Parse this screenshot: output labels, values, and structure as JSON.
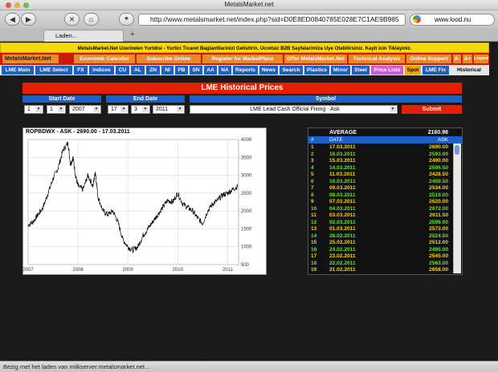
{
  "window": {
    "title": "MetalsMarket.net"
  },
  "toolbar": {
    "back_label": "◀",
    "forward_label": "▶",
    "stop_label": "✕",
    "home_label": "⌂",
    "url": "http://www.metalsmarket.net/index.php?sid=D0E8ED0840785E028E7C1AE9B985",
    "search_value": "www.lood.nu"
  },
  "tabs": [
    {
      "label": "Laden..."
    }
  ],
  "newtab_label": "+",
  "banner": "MetalsMarket.Net Uzerinden Yurtdisi - Yurtici Ticaret Baglantilarinizi Gelistirin. Ucretsiz B2B Sayfalarimiza Uye Olabilirsiniz. Kayit icin Tiklayiniz.",
  "menu1": {
    "brand": "MetalsMarket.Net",
    "items": [
      "Economic Calendar",
      "Subscribe Online",
      "Register for MarketPlace",
      "Offer MetalsMarket.Net",
      "Technical Analysis",
      "Online Support",
      "A-",
      "A+",
      "Logout"
    ]
  },
  "menu2": {
    "items": [
      "LME Main",
      "LME Select",
      "FX",
      "Indices",
      "CU",
      "AL",
      "ZN",
      "NI",
      "PB",
      "SN",
      "AA",
      "NA",
      "Reports",
      "News",
      "Search",
      "Plastics",
      "Minor",
      "Steel",
      "Price Lists",
      "Spot",
      "LME Fix",
      "Historical"
    ]
  },
  "heading": "LME Historical Prices",
  "form": {
    "start_label": "Start Date",
    "end_label": "End Date",
    "symbol_label": "Symbol",
    "start_day": "1",
    "start_month": "1",
    "start_year": "2007",
    "end_day": "17",
    "end_month": "3",
    "end_year": "2011",
    "symbol": "LME Lead Cash Official Fixing - Ask",
    "submit": "Submit"
  },
  "chart_title": "ROPBDWX - ASK - 2690.00 - 17.03.2011",
  "chart_data": {
    "type": "line",
    "title": "ROPBDWX - ASK - 2690.00 - 17.03.2011",
    "x": [
      2007.0,
      2007.1,
      2007.2,
      2007.3,
      2007.4,
      2007.5,
      2007.6,
      2007.7,
      2007.8,
      2007.85,
      2007.9,
      2007.95,
      2008.0,
      2008.1,
      2008.2,
      2008.3,
      2008.35,
      2008.4,
      2008.5,
      2008.6,
      2008.7,
      2008.8,
      2008.9,
      2009.0,
      2009.1,
      2009.2,
      2009.3,
      2009.4,
      2009.5,
      2009.6,
      2009.7,
      2009.8,
      2009.9,
      2010.0,
      2010.1,
      2010.2,
      2010.3,
      2010.4,
      2010.5,
      2010.6,
      2010.7,
      2010.8,
      2010.9,
      2011.0,
      2011.1,
      2011.2
    ],
    "values": [
      1600,
      1700,
      1900,
      2100,
      2500,
      2900,
      3200,
      3700,
      3900,
      3300,
      3500,
      3000,
      2700,
      2600,
      3000,
      2700,
      3100,
      2400,
      2000,
      1900,
      2000,
      1700,
      1200,
      1000,
      900,
      1000,
      1300,
      1500,
      1700,
      1900,
      2100,
      2300,
      2250,
      2500,
      2200,
      2100,
      2000,
      1800,
      1650,
      2000,
      2200,
      2300,
      2450,
      2500,
      2600,
      2690
    ],
    "xticks": [
      "2007",
      "2008",
      "2009",
      "2010",
      "2011"
    ],
    "yticks": [
      "4000",
      "3500",
      "3000",
      "2500",
      "2000",
      "1500",
      "1000",
      "500"
    ],
    "xlim": [
      2007.0,
      2011.22
    ],
    "ylim": [
      500,
      4000
    ],
    "grid": true,
    "color": "#000000"
  },
  "table": {
    "average_label": "AVERAGE",
    "average_value": "2160.96",
    "col_num": "#",
    "col_date": "DATE",
    "col_ask": "ASK",
    "rows": [
      {
        "n": "1",
        "date": "17.03.2011",
        "ask": "2690.00"
      },
      {
        "n": "2",
        "date": "16.03.2011",
        "ask": "2593.00"
      },
      {
        "n": "3",
        "date": "15.03.2011",
        "ask": "2490.00"
      },
      {
        "n": "4",
        "date": "14.03.2011",
        "ask": "2506.50"
      },
      {
        "n": "5",
        "date": "11.03.2011",
        "ask": "2428.50"
      },
      {
        "n": "6",
        "date": "10.03.2011",
        "ask": "2459.50"
      },
      {
        "n": "7",
        "date": "09.03.2011",
        "ask": "2534.00"
      },
      {
        "n": "8",
        "date": "08.03.2011",
        "ask": "2519.00"
      },
      {
        "n": "9",
        "date": "07.03.2011",
        "ask": "2620.00"
      },
      {
        "n": "10",
        "date": "04.03.2011",
        "ask": "2672.00"
      },
      {
        "n": "11",
        "date": "03.03.2011",
        "ask": "2611.50"
      },
      {
        "n": "12",
        "date": "02.03.2011",
        "ask": "2599.00"
      },
      {
        "n": "13",
        "date": "01.03.2011",
        "ask": "2573.00"
      },
      {
        "n": "14",
        "date": "28.02.2011",
        "ask": "2524.50"
      },
      {
        "n": "15",
        "date": "25.02.2011",
        "ask": "2512.00"
      },
      {
        "n": "16",
        "date": "24.02.2011",
        "ask": "2485.00"
      },
      {
        "n": "17",
        "date": "23.02.2011",
        "ask": "2545.00"
      },
      {
        "n": "18",
        "date": "22.02.2011",
        "ask": "2563.00"
      },
      {
        "n": "19",
        "date": "21.02.2011",
        "ask": "2658.00"
      }
    ]
  },
  "status": "Bezig met het laden van milkserver.metalsmarket.net...",
  "colors": {
    "accent_red": "#e42000",
    "nav_blue": "#1b61c9",
    "banner_yellow": "#f7d80c",
    "row_even": "#ffd400",
    "row_odd": "#5fe832"
  }
}
